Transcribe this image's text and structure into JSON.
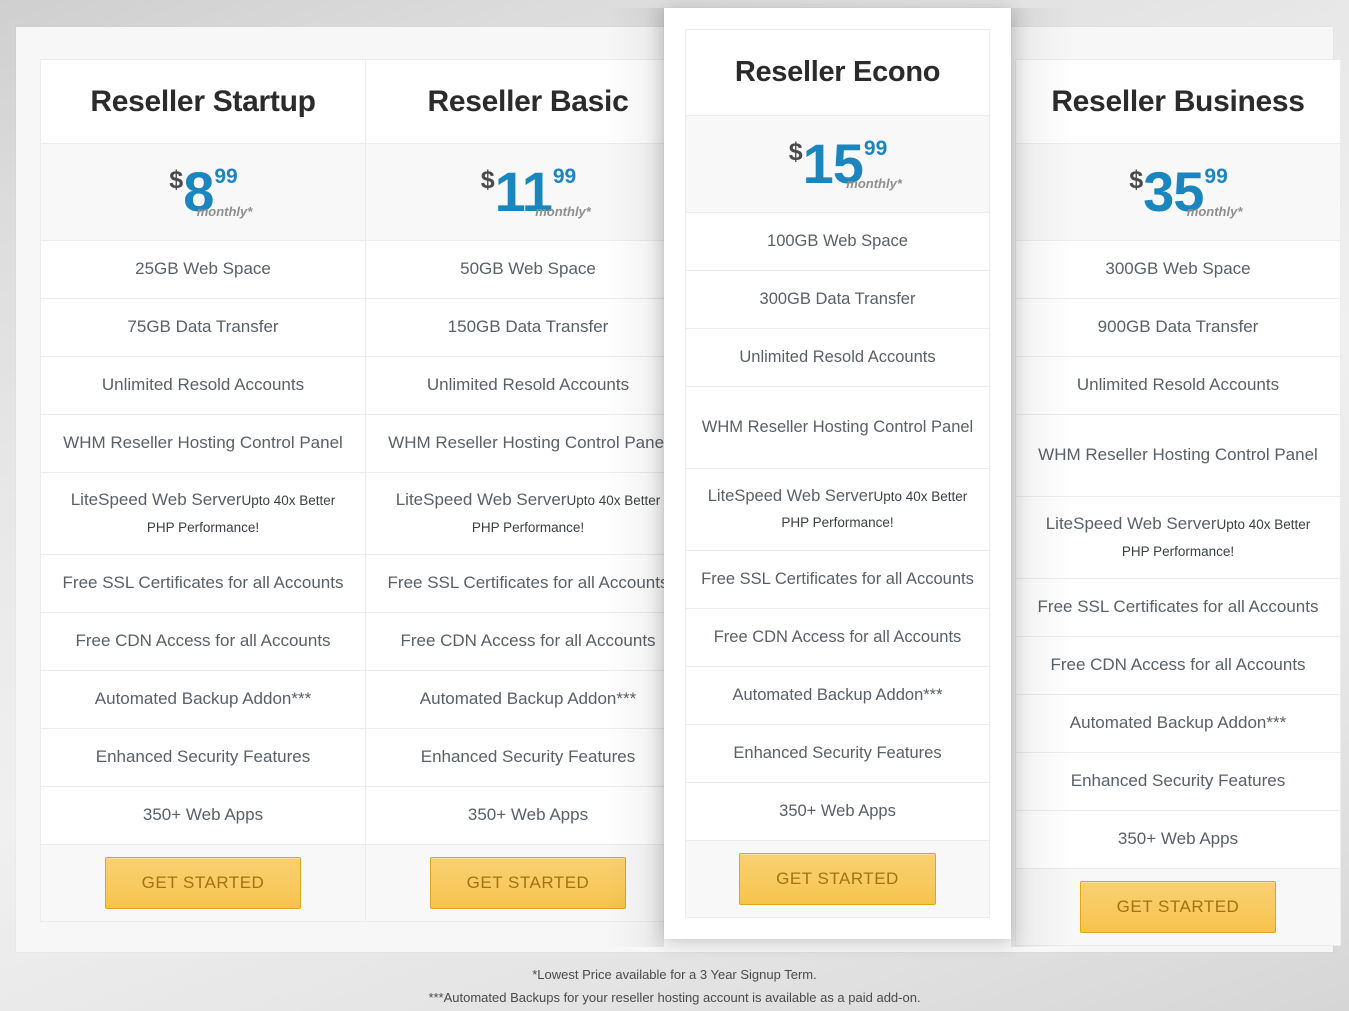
{
  "colors": {
    "accent_blue": "#1b86bd",
    "cta_bg": "#f8cb62",
    "cta_border": "#e0a51f",
    "cta_text": "#a07313",
    "feature_text": "#5a6067",
    "title_text": "#2b2b2b",
    "row_border": "#ececec",
    "panel_bg": "#f7f7f7"
  },
  "plans": [
    {
      "name": "Reseller Startup",
      "currency": "$",
      "amount": "8",
      "cents": "99",
      "period": "monthly*",
      "featured": false,
      "cta_label": "GET STARTED",
      "features": [
        {
          "main": "25GB Web Space",
          "sub": ""
        },
        {
          "main": "75GB Data Transfer",
          "sub": ""
        },
        {
          "main": "Unlimited Resold Accounts",
          "sub": ""
        },
        {
          "main": "WHM Reseller Hosting Control Panel",
          "sub": ""
        },
        {
          "main": "LiteSpeed Web Server",
          "sub": "Upto 40x Better PHP Performance!"
        },
        {
          "main": "Free SSL Certificates for all Accounts",
          "sub": ""
        },
        {
          "main": "Free CDN Access for all Accounts",
          "sub": ""
        },
        {
          "main": "Automated Backup Addon***",
          "sub": ""
        },
        {
          "main": "Enhanced Security Features",
          "sub": ""
        },
        {
          "main": "350+ Web Apps",
          "sub": ""
        }
      ]
    },
    {
      "name": "Reseller Basic",
      "currency": "$",
      "amount": "11",
      "cents": "99",
      "period": "monthly*",
      "featured": false,
      "cta_label": "GET STARTED",
      "features": [
        {
          "main": "50GB Web Space",
          "sub": ""
        },
        {
          "main": "150GB Data Transfer",
          "sub": ""
        },
        {
          "main": "Unlimited Resold Accounts",
          "sub": ""
        },
        {
          "main": "WHM Reseller Hosting Control Panel",
          "sub": ""
        },
        {
          "main": "LiteSpeed Web Server",
          "sub": "Upto 40x Better PHP Performance!"
        },
        {
          "main": "Free SSL Certificates for all Accounts",
          "sub": ""
        },
        {
          "main": "Free CDN Access for all Accounts",
          "sub": ""
        },
        {
          "main": "Automated Backup Addon***",
          "sub": ""
        },
        {
          "main": "Enhanced Security Features",
          "sub": ""
        },
        {
          "main": "350+ Web Apps",
          "sub": ""
        }
      ]
    },
    {
      "name": "Reseller Econo",
      "currency": "$",
      "amount": "15",
      "cents": "99",
      "period": "monthly*",
      "featured": true,
      "cta_label": "GET STARTED",
      "features": [
        {
          "main": "100GB Web Space",
          "sub": ""
        },
        {
          "main": "300GB Data Transfer",
          "sub": ""
        },
        {
          "main": "Unlimited Resold Accounts",
          "sub": ""
        },
        {
          "main": "WHM Reseller Hosting Control Panel",
          "sub": ""
        },
        {
          "main": "LiteSpeed Web Server",
          "sub": "Upto 40x Better PHP Performance!"
        },
        {
          "main": "Free SSL Certificates for all Accounts",
          "sub": ""
        },
        {
          "main": "Free CDN Access for all Accounts",
          "sub": ""
        },
        {
          "main": "Automated Backup Addon***",
          "sub": ""
        },
        {
          "main": "Enhanced Security Features",
          "sub": ""
        },
        {
          "main": "350+ Web Apps",
          "sub": ""
        }
      ]
    },
    {
      "name": "Reseller Business",
      "currency": "$",
      "amount": "35",
      "cents": "99",
      "period": "monthly*",
      "featured": false,
      "cta_label": "GET STARTED",
      "features": [
        {
          "main": "300GB Web Space",
          "sub": ""
        },
        {
          "main": "900GB Data Transfer",
          "sub": ""
        },
        {
          "main": "Unlimited Resold Accounts",
          "sub": ""
        },
        {
          "main": "WHM Reseller Hosting Control Panel",
          "sub": ""
        },
        {
          "main": "LiteSpeed Web Server",
          "sub": "Upto 40x Better PHP Performance!"
        },
        {
          "main": "Free SSL Certificates for all Accounts",
          "sub": ""
        },
        {
          "main": "Free CDN Access for all Accounts",
          "sub": ""
        },
        {
          "main": "Automated Backup Addon***",
          "sub": ""
        },
        {
          "main": "Enhanced Security Features",
          "sub": ""
        },
        {
          "main": "350+ Web Apps",
          "sub": ""
        }
      ]
    }
  ],
  "footnotes": [
    "*Lowest Price available for a 3 Year Signup Term.",
    "***Automated Backups for your reseller hosting account is available as a paid add-on."
  ]
}
